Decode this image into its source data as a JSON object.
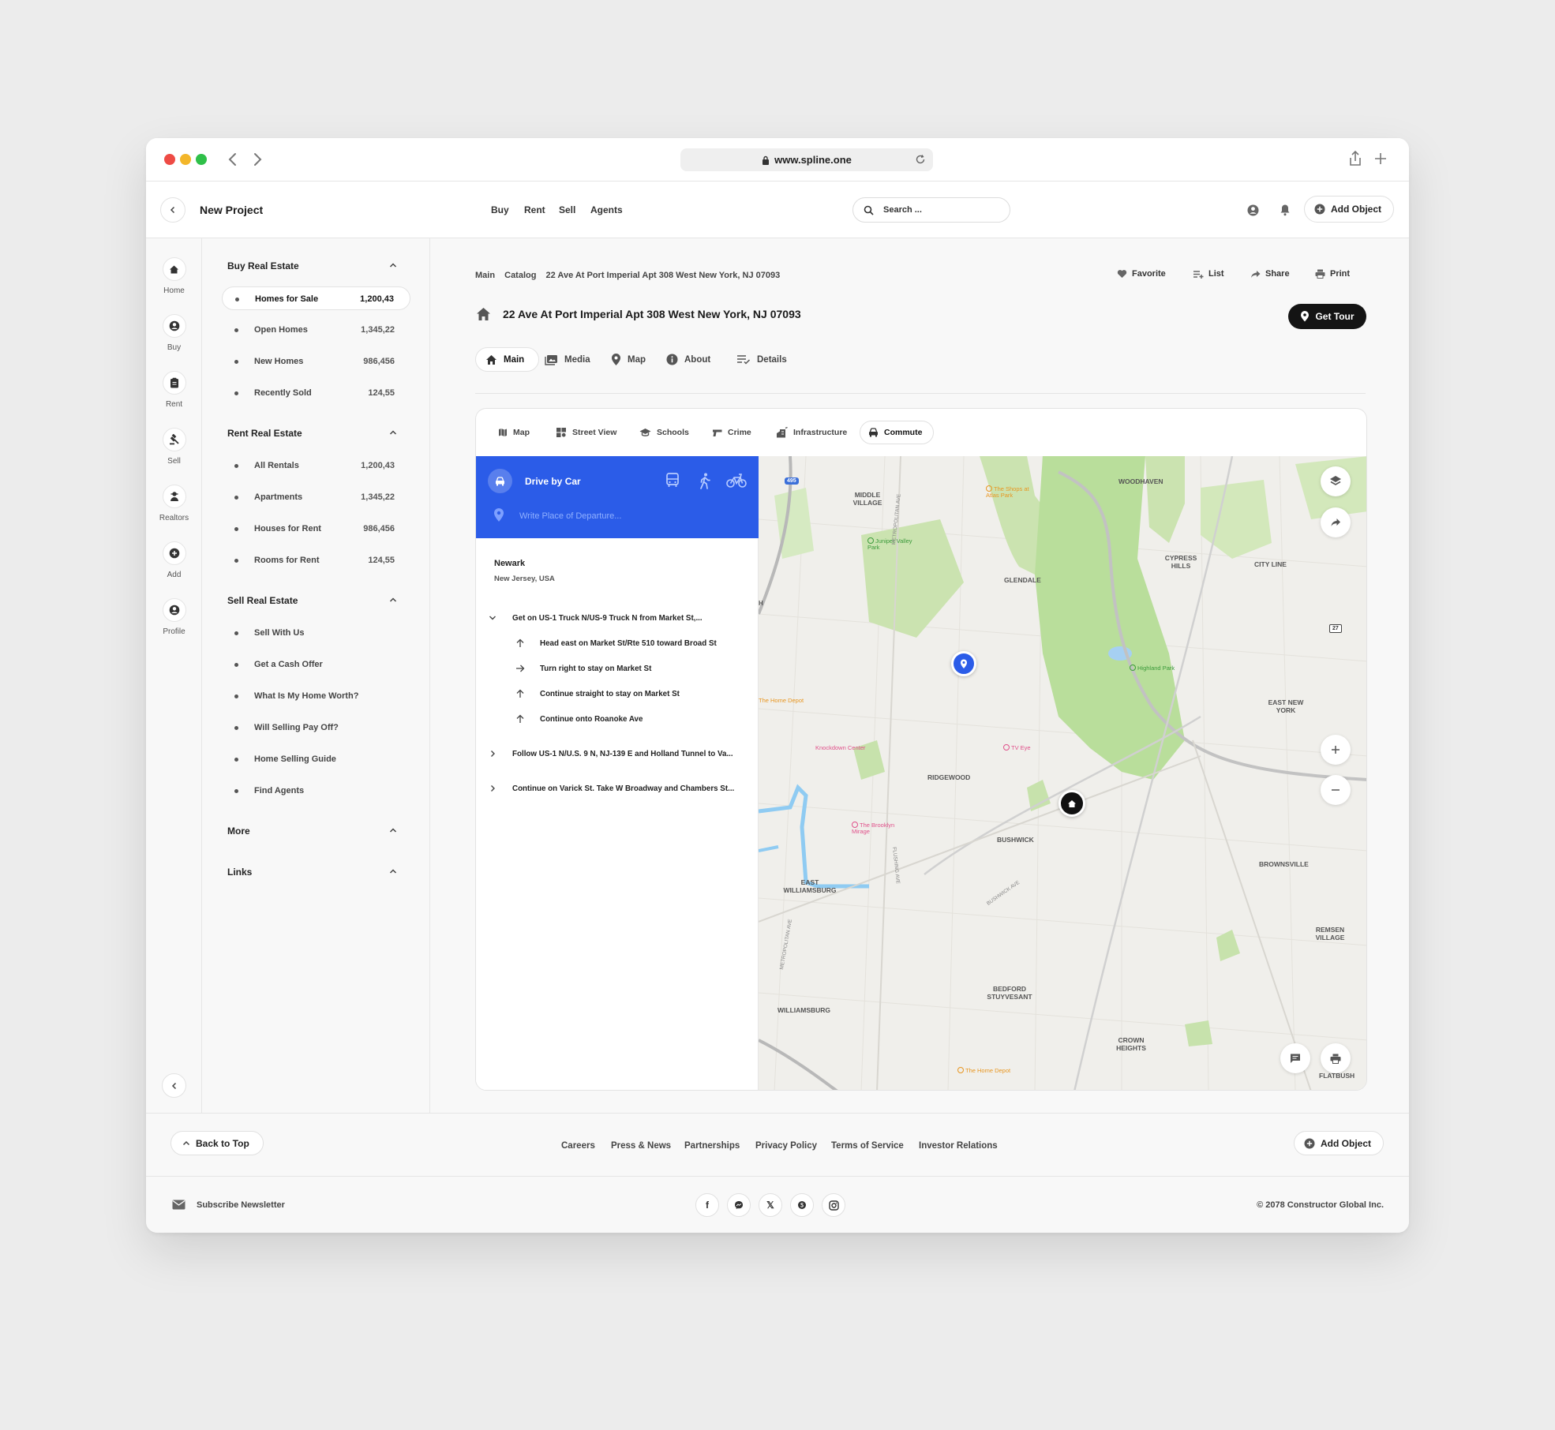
{
  "browser": {
    "url": "www.spline.one"
  },
  "header": {
    "title": "New Project",
    "nav": [
      "Buy",
      "Rent",
      "Sell",
      "Agents"
    ],
    "search_placeholder": "Search ...",
    "add_object": "Add Object"
  },
  "rail": [
    "Home",
    "Buy",
    "Rent",
    "Sell",
    "Realtors",
    "Add",
    "Profile"
  ],
  "sidebar": {
    "buy": {
      "title": "Buy Real Estate",
      "items": [
        {
          "label": "Homes for Sale",
          "count": "1,200,43"
        },
        {
          "label": "Open Homes",
          "count": "1,345,22"
        },
        {
          "label": "New Homes",
          "count": "986,456"
        },
        {
          "label": "Recently Sold",
          "count": "124,55"
        }
      ]
    },
    "rent": {
      "title": "Rent Real Estate",
      "items": [
        {
          "label": "All Rentals",
          "count": "1,200,43"
        },
        {
          "label": "Apartments",
          "count": "1,345,22"
        },
        {
          "label": "Houses for Rent",
          "count": "986,456"
        },
        {
          "label": "Rooms for Rent",
          "count": "124,55"
        }
      ]
    },
    "sell": {
      "title": "Sell Real Estate",
      "items": [
        "Sell With Us",
        "Get a Cash Offer",
        "What Is My Home Worth?",
        "Will Selling Pay Off?",
        "Home Selling Guide",
        "Find Agents"
      ]
    },
    "more": "More",
    "links": "Links"
  },
  "breadcrumb": [
    "Main",
    "Catalog",
    "22 Ave At Port Imperial Apt 308 West New York, NJ 07093"
  ],
  "actions": [
    "Favorite",
    "List",
    "Share",
    "Print"
  ],
  "page_title": "22 Ave At Port Imperial Apt 308 West New York, NJ 07093",
  "get_tour": "Get Tour",
  "tabs": [
    "Main",
    "Media",
    "Map",
    "About",
    "Details"
  ],
  "subtabs": [
    "Map",
    "Street View",
    "Schools",
    "Crime",
    "Infrastructure",
    "Commute"
  ],
  "directions": {
    "mode": "Drive by Car",
    "departure_placeholder": "Write Place of Departure...",
    "origin_city": "Newark",
    "origin_state": "New Jersey, USA",
    "steps": [
      {
        "text": "Get on US-1 Truck N/US-9 Truck N from Market St,...",
        "substeps": [
          "Head east on Market St/Rte 510 toward Broad St",
          "Turn right to stay on Market St",
          "Continue straight to stay on Market St",
          "Continue onto Roanoke Ave"
        ]
      },
      {
        "text": "Follow US-1 N/U.S. 9 N, NJ-139 E and Holland Tunnel to Va..."
      },
      {
        "text": "Continue on Varick St. Take W Broadway and Chambers St..."
      }
    ]
  },
  "map": {
    "neighborhoods": [
      "MIDDLE VILLAGE",
      "WOODHAVEN",
      "GLENDALE",
      "CYPRESS HILLS",
      "CITY LINE",
      "EAST NEW YORK",
      "RIDGEWOOD",
      "BUSHWICK",
      "BROWNSVILLE",
      "EAST WILLIAMSBURG",
      "REMSEN VILLAGE",
      "BEDFORD STUYVESANT",
      "WILLIAMSBURG",
      "CROWN HEIGHTS",
      "FLATBUSH"
    ],
    "pois": [
      "The Shops at Atlas Park",
      "Juniper Valley Park",
      "Highland Park",
      "The Home Depot",
      "Knockdown Center",
      "TV Eye",
      "The Brooklyn Mirage",
      "The Home Depot"
    ],
    "streets": [
      "METROPOLITAN AVE",
      "FLUSHING AVE",
      "BUSHWICK AVE",
      "METROPOLITAN AVE"
    ],
    "shields": [
      "495",
      "27",
      "H"
    ]
  },
  "footer": {
    "back_to_top": "Back to Top",
    "links": [
      "Careers",
      "Press & News",
      "Partnerships",
      "Privacy Policy",
      "Terms of Service",
      "Investor Relations"
    ],
    "add_object": "Add Object",
    "newsletter": "Subscribe Newsletter",
    "copyright": "© 2078 Constructor Global Inc."
  }
}
